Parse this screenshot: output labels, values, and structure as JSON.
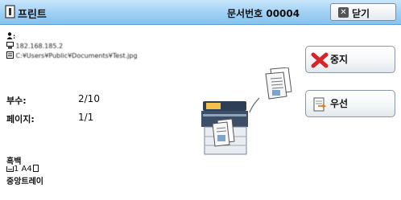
{
  "title": "프린트",
  "doc_number": "문서번호 00004",
  "close_label": "닫기",
  "info": {
    "user_label": ":",
    "ip_label": "182.168.185.2",
    "file_path": "C:¥Users¥Public¥Documents¥Test.jpg"
  },
  "fields": {
    "copies_label": "부수:",
    "copies_value": "2/10",
    "pages_label": "페이지:",
    "pages_value": "1/1"
  },
  "job": {
    "color_mode": "흑백",
    "paper": "1   A4",
    "tray": "중앙트레이"
  },
  "buttons": {
    "stop_label": "중지",
    "priority_label": "우선"
  }
}
